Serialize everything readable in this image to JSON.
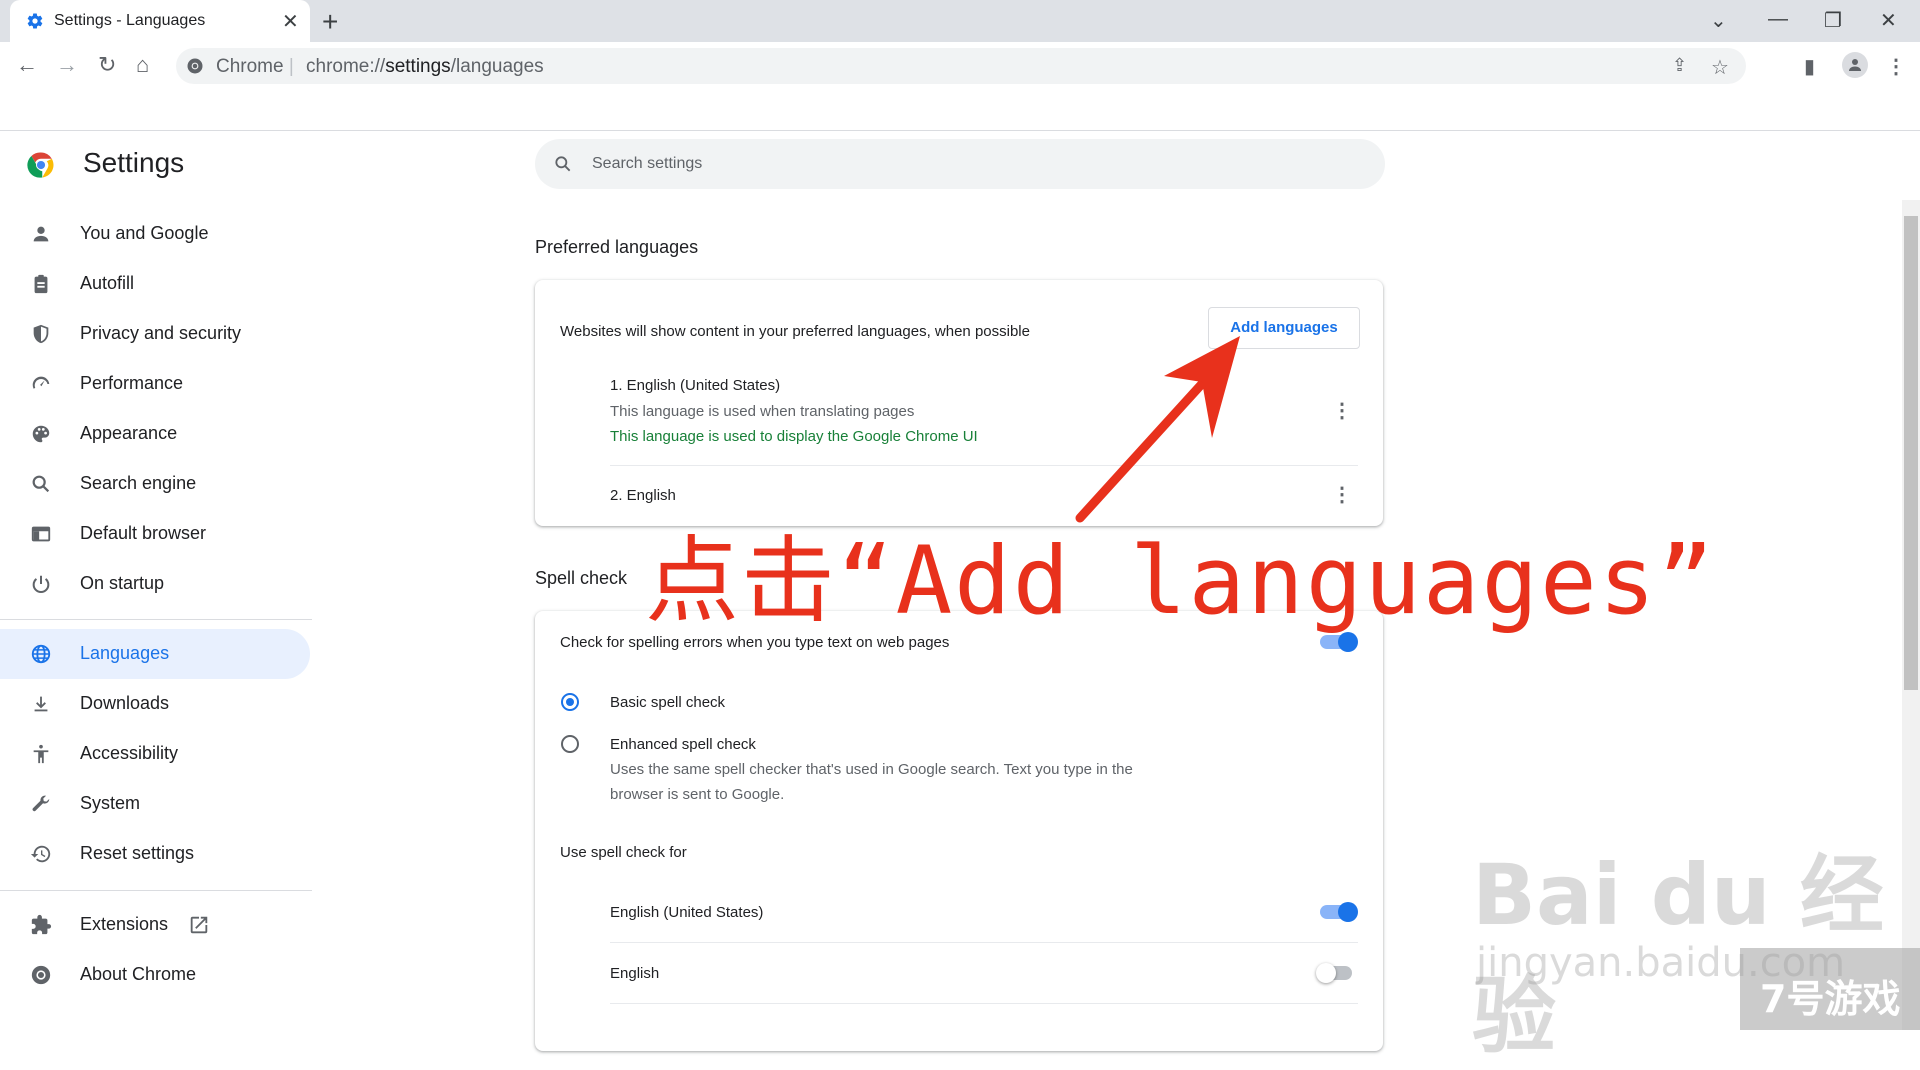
{
  "tab": {
    "title": "Settings - Languages",
    "close": "✕"
  },
  "new_tab": "+",
  "window": {
    "dropdown": "⌄",
    "minimize": "—",
    "restore": "❐",
    "close": "✕"
  },
  "toolbar": {
    "back": "←",
    "forward": "→",
    "reload": "↻",
    "home": "⌂",
    "share": "⇪",
    "bookmark": "☆",
    "sidepanel": "▮",
    "menu": "⋮"
  },
  "omnibox": {
    "prefix": "Chrome",
    "separator": "|",
    "url_scheme": "chrome://",
    "url_host": "settings",
    "url_path": "/languages"
  },
  "settings_title": "Settings",
  "sidebar": {
    "items": [
      {
        "label": "You and Google",
        "icon": "person-icon"
      },
      {
        "label": "Autofill",
        "icon": "clipboard-icon"
      },
      {
        "label": "Privacy and security",
        "icon": "shield-icon"
      },
      {
        "label": "Performance",
        "icon": "speedometer-icon"
      },
      {
        "label": "Appearance",
        "icon": "palette-icon"
      },
      {
        "label": "Search engine",
        "icon": "search-icon"
      },
      {
        "label": "Default browser",
        "icon": "browser-icon"
      },
      {
        "label": "On startup",
        "icon": "power-icon"
      },
      {
        "label": "Languages",
        "icon": "globe-icon",
        "active": true
      },
      {
        "label": "Downloads",
        "icon": "download-icon"
      },
      {
        "label": "Accessibility",
        "icon": "accessibility-icon"
      },
      {
        "label": "System",
        "icon": "wrench-icon"
      },
      {
        "label": "Reset settings",
        "icon": "history-icon"
      },
      {
        "label": "Extensions",
        "icon": "puzzle-icon"
      },
      {
        "label": "About Chrome",
        "icon": "chrome-icon"
      }
    ]
  },
  "search": {
    "placeholder": "Search settings"
  },
  "preferred": {
    "heading": "Preferred languages",
    "description": "Websites will show content in your preferred languages, when possible",
    "add_button": "Add languages",
    "languages": [
      {
        "name": "1. English (United States)",
        "note1": "This language is used when translating pages",
        "note2": "This language is used to display the Google Chrome UI"
      },
      {
        "name": "2. English"
      }
    ]
  },
  "spell": {
    "heading": "Spell check",
    "toggle_label": "Check for spelling errors when you type text on web pages",
    "toggle_on": true,
    "basic": "Basic spell check",
    "enhanced": "Enhanced spell check",
    "enhanced_desc1": "Uses the same spell checker that's used in Google search. Text you type in the",
    "enhanced_desc2": "browser is sent to Google.",
    "use_for": "Use spell check for",
    "langs": [
      {
        "name": "English (United States)",
        "on": true
      },
      {
        "name": "English",
        "on": false
      }
    ]
  },
  "annotation": "点击“Add languages”",
  "watermark": {
    "brand": "Bai du 经验",
    "domain": "jingyan.baidu.com",
    "corner": "7号游戏"
  },
  "colors": {
    "accent": "#1a73e8",
    "green_note": "#188038",
    "annotation_red": "#e8311c"
  }
}
